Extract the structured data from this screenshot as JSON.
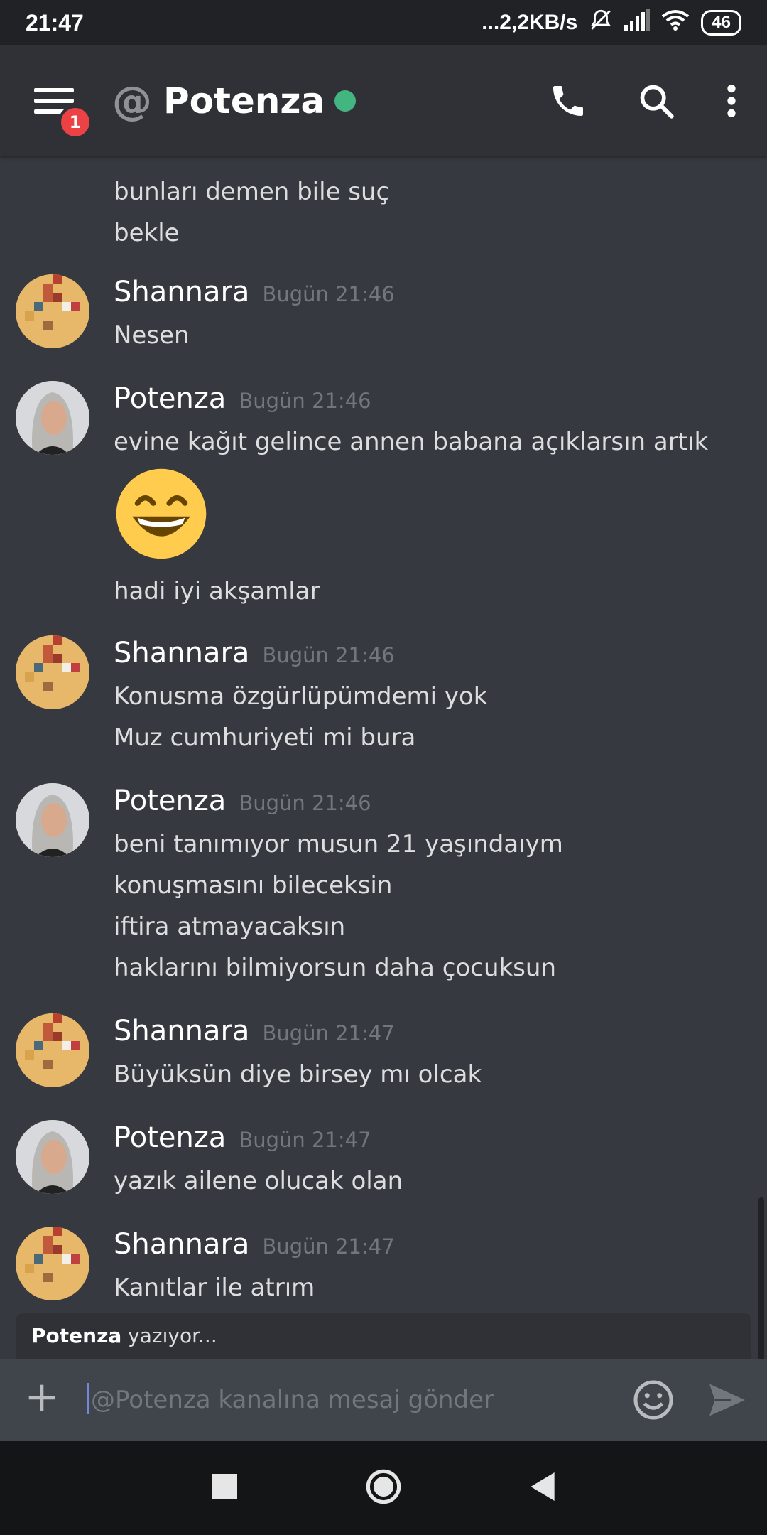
{
  "status_bar": {
    "time": "21:47",
    "speed": "...2,2KB/s",
    "battery": "46"
  },
  "header": {
    "badge": "1",
    "at_symbol": "@",
    "title": "Potenza",
    "online_color": "#43b581"
  },
  "partial_lines": [
    "bunları demen bile suç",
    "bekle"
  ],
  "messages": [
    {
      "author": "Shannara",
      "time": "Bugün 21:46",
      "lines": [
        "Nesen"
      ]
    },
    {
      "author": "Potenza",
      "time": "Bugün 21:46",
      "lines": [
        "evine kağıt gelince annen babana açıklarsın artık"
      ],
      "emoji": "grinning-face-emoji",
      "after_lines": [
        "hadi iyi akşamlar"
      ]
    },
    {
      "author": "Shannara",
      "time": "Bugün 21:46",
      "lines": [
        "Konusma özgürlüpümdemi yok",
        "Muz cumhuriyeti mi bura"
      ]
    },
    {
      "author": "Potenza",
      "time": "Bugün 21:46",
      "lines": [
        "beni tanımıyor musun 21 yaşındaıym",
        "konuşmasını bileceksin",
        "iftira atmayacaksın",
        "haklarını bilmiyorsun daha çocuksun"
      ]
    },
    {
      "author": "Shannara",
      "time": "Bugün 21:47",
      "lines": [
        "Büyüksün diye birsey mı olcak"
      ]
    },
    {
      "author": "Potenza",
      "time": "Bugün 21:47",
      "lines": [
        "yazık ailene olucak olan"
      ]
    },
    {
      "author": "Shannara",
      "time": "Bugün 21:47",
      "lines": [
        "Kanıtlar ile atrım"
      ]
    }
  ],
  "typing": {
    "user": "Potenza",
    "text": " yazıyor..."
  },
  "composer": {
    "placeholder": "@Potenza kanalına mesaj gönder"
  },
  "colors": {
    "background": "#36393f",
    "header": "#2f3136",
    "accent": "#7289da",
    "badge": "#ed4245"
  }
}
